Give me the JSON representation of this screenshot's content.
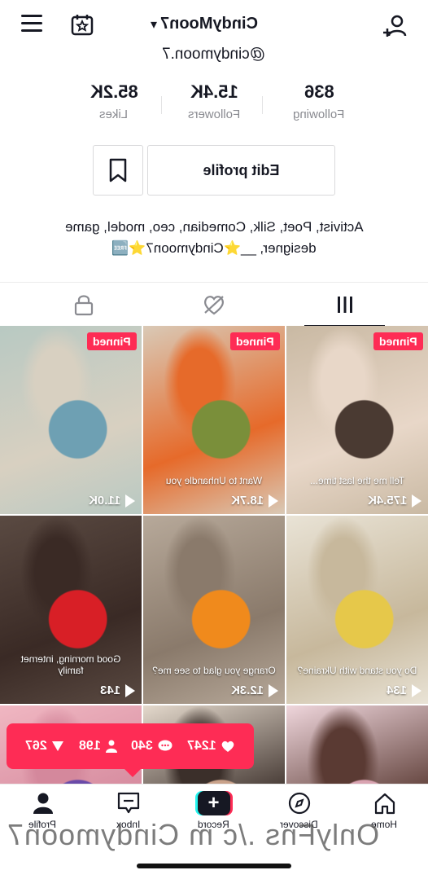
{
  "header": {
    "username": "CindyMoon7",
    "handle": "@cindymoon.7"
  },
  "stats": [
    {
      "value": "836",
      "label": "Following"
    },
    {
      "value": "15.4K",
      "label": "Followers"
    },
    {
      "value": "85.2K",
      "label": "Likes"
    }
  ],
  "buttons": {
    "edit_profile": "Edit profile"
  },
  "bio": {
    "line1": "Activist, Poet, Silk, Comedian, ceo, model, game",
    "line2": "designer, __⭐Cindymoon7⭐🆓"
  },
  "tabs": [
    "videos",
    "liked",
    "private"
  ],
  "videos": [
    {
      "views": "175.4K",
      "pinned": "Pinned",
      "caption": "Tell me the last time...",
      "colors": [
        "#c9b9a3",
        "#4a3a32",
        "#e8d7c8"
      ]
    },
    {
      "views": "18.7K",
      "pinned": "Pinned",
      "caption": "Want to Unhandle you",
      "colors": [
        "#d9c9b6",
        "#7a8f3a",
        "#e66a2a"
      ]
    },
    {
      "views": "11.0K",
      "pinned": "Pinned",
      "caption": "",
      "colors": [
        "#b8c9c2",
        "#6ea0b3",
        "#d8d0c1"
      ]
    },
    {
      "views": "134",
      "pinned": "",
      "caption": "Do you stand with Ukraine?",
      "colors": [
        "#e9e3d6",
        "#e6c84a",
        "#c7b89c"
      ]
    },
    {
      "views": "12.3K",
      "pinned": "",
      "caption": "Orange you glad to see me?",
      "colors": [
        "#b7a99a",
        "#f08a1c",
        "#8a7a6b"
      ]
    },
    {
      "views": "143",
      "pinned": "",
      "caption": "Good morning, internet family",
      "colors": [
        "#5a4a42",
        "#d81f26",
        "#3a2a25"
      ]
    },
    {
      "views": "",
      "pinned": "",
      "caption": "",
      "colors": [
        "#efd6dc",
        "#d9a3b1",
        "#5a3a33"
      ]
    },
    {
      "views": "",
      "pinned": "",
      "caption": "",
      "colors": [
        "#e4d9cc",
        "#c9a28a",
        "#3b2f2a"
      ]
    },
    {
      "views": "",
      "pinned": "",
      "caption": "",
      "colors": [
        "#f0b7c2",
        "#6a4aa8",
        "#d4889c"
      ]
    }
  ],
  "toast": {
    "likes": "1247",
    "comments": "340",
    "followers": "198",
    "shares": "267"
  },
  "nav": [
    {
      "label": "Home"
    },
    {
      "label": "Discover"
    },
    {
      "label": "Record"
    },
    {
      "label": "Inbox"
    },
    {
      "label": "Profile"
    }
  ],
  "watermark": "OnlyFns ./c m Cindymoon7"
}
